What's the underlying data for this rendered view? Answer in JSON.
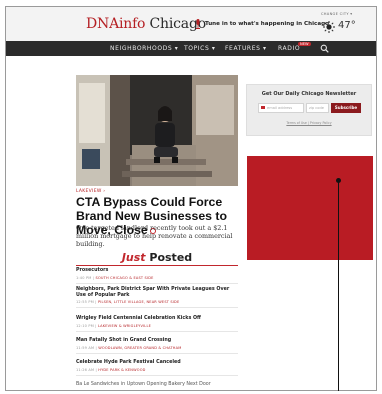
{
  "brand": {
    "name_red": "DNAinfo",
    "name_dark": " Chicago",
    "tune_in": "Tune in to what's happening in Chicago"
  },
  "weather": {
    "label": "CHANGE CITY ▾",
    "temp": "47°",
    "icon": "sun-icon"
  },
  "nav": {
    "items": [
      "NEIGHBORHOODS ▾",
      "TOPICS ▾",
      "FEATURES ▾",
      "RADIO"
    ],
    "new_badge": "NEW",
    "search_icon": "search-icon"
  },
  "lead": {
    "crumb": "LAKEVIEW ›",
    "headline": "CTA Bypass Could Force Brand New Businesses to Move, Close",
    "dek": "One targeted landlord recently took out a $2.1 million mortgage to help renovate a commercial building."
  },
  "just_posted": {
    "em": "Just",
    "rest": " Posted",
    "stories": [
      {
        "title": "Prosecutors",
        "time": "1:40 PM",
        "tag": "SOUTH CHICAGO & EAST SIDE"
      },
      {
        "title": "Neighbors, Park District Spar With Private Leagues Over Use of Popular Park",
        "time": "12:55 PM",
        "tag": "PILSEN, LITTLE VILLAGE, NEAR WEST SIDE"
      },
      {
        "title": "Wrigley Field Centennial Celebration Kicks Off",
        "time": "12:10 PM",
        "tag": "LAKEVIEW & WRIGLEYVILLE"
      },
      {
        "title": "Man Fatally Shot in Grand Crossing",
        "time": "11:59 AM",
        "tag": "WOODLAWN, GREATER GRAND & CHATHAM"
      },
      {
        "title": "Celebrate Hyde Park Festival Canceled",
        "time": "11:26 AM",
        "tag": "HYDE PARK & KENWOOD"
      },
      {
        "title": "Ba Le Sandwiches in Uptown Opening Bakery Next Door",
        "time": "",
        "tag": ""
      }
    ]
  },
  "newsletter": {
    "title": "Get Our Daily Chicago Newsletter",
    "email_placeholder": "email address",
    "zip_placeholder": "zip code",
    "button": "Subscribe",
    "links": "Terms of Use | Privacy Policy"
  },
  "colors": {
    "brand_red": "#b52024",
    "nav_bg": "#2b2b2b",
    "ad_red": "#b91c24"
  }
}
